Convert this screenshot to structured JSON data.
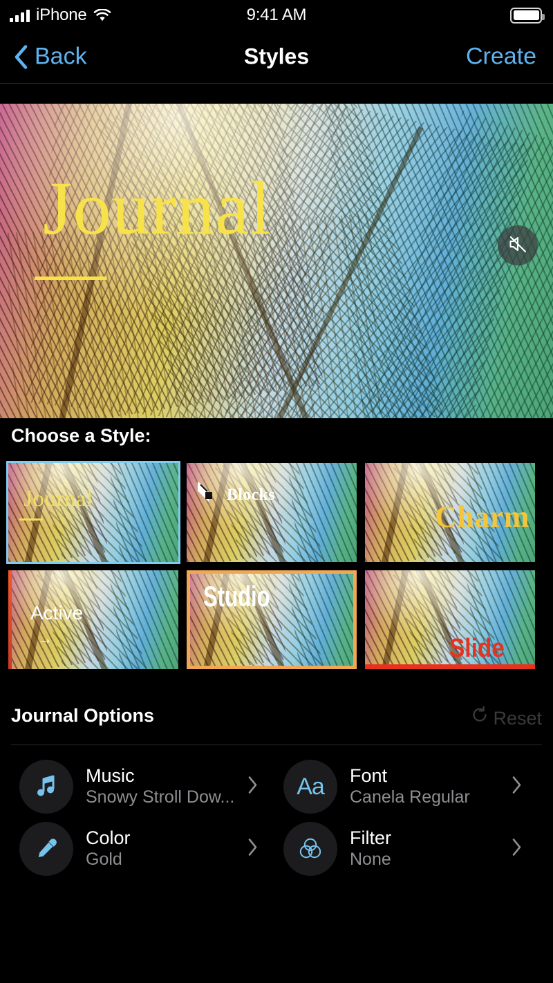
{
  "status_bar": {
    "carrier": "iPhone",
    "time": "9:41 AM",
    "signal_icon": "cellular-bars-icon",
    "wifi_icon": "wifi-icon",
    "battery_icon": "battery-full-icon"
  },
  "nav": {
    "back_label": "Back",
    "title": "Styles",
    "create_label": "Create",
    "back_icon": "chevron-left-icon"
  },
  "preview": {
    "title": "Journal",
    "mute_icon": "speaker-mute-icon",
    "accent_color": "#F7E24A"
  },
  "styles_section": {
    "heading": "Choose a Style:",
    "selected_index": 0,
    "selection_color": "#7FCDEE",
    "items": [
      {
        "name": "Journal",
        "label": "Journal",
        "selected": true,
        "text_color": "#F2DE63"
      },
      {
        "name": "Blocks",
        "label": "Blocks",
        "selected": false,
        "text_color": "#FFFFFF"
      },
      {
        "name": "Charm",
        "label": "Charm",
        "selected": false,
        "text_color": "#F5C53A"
      },
      {
        "name": "Active",
        "label": "Active",
        "selected": false,
        "text_color": "#FFFFFF",
        "accent": "#F05A28"
      },
      {
        "name": "Studio",
        "label": "Studio",
        "selected": false,
        "text_color": "#FFFFFF",
        "accent": "#F0A855"
      },
      {
        "name": "Slide",
        "label": "Slide",
        "selected": false,
        "text_color": "#E8321E",
        "accent": "#E8321E"
      }
    ]
  },
  "options_section": {
    "heading": "Journal Options",
    "reset_label": "Reset",
    "reset_icon": "refresh-icon",
    "rows": [
      {
        "title": "Music",
        "value": "Snowy Stroll Dow...",
        "icon": "music-note-icon",
        "chevron": "chevron-right-icon"
      },
      {
        "title": "Font",
        "value": "Canela Regular",
        "icon": "aa-text-icon",
        "chevron": "chevron-right-icon"
      },
      {
        "title": "Color",
        "value": "Gold",
        "icon": "eyedropper-icon",
        "chevron": "chevron-right-icon"
      },
      {
        "title": "Filter",
        "value": "None",
        "icon": "filter-circles-icon",
        "chevron": "chevron-right-icon"
      }
    ]
  }
}
